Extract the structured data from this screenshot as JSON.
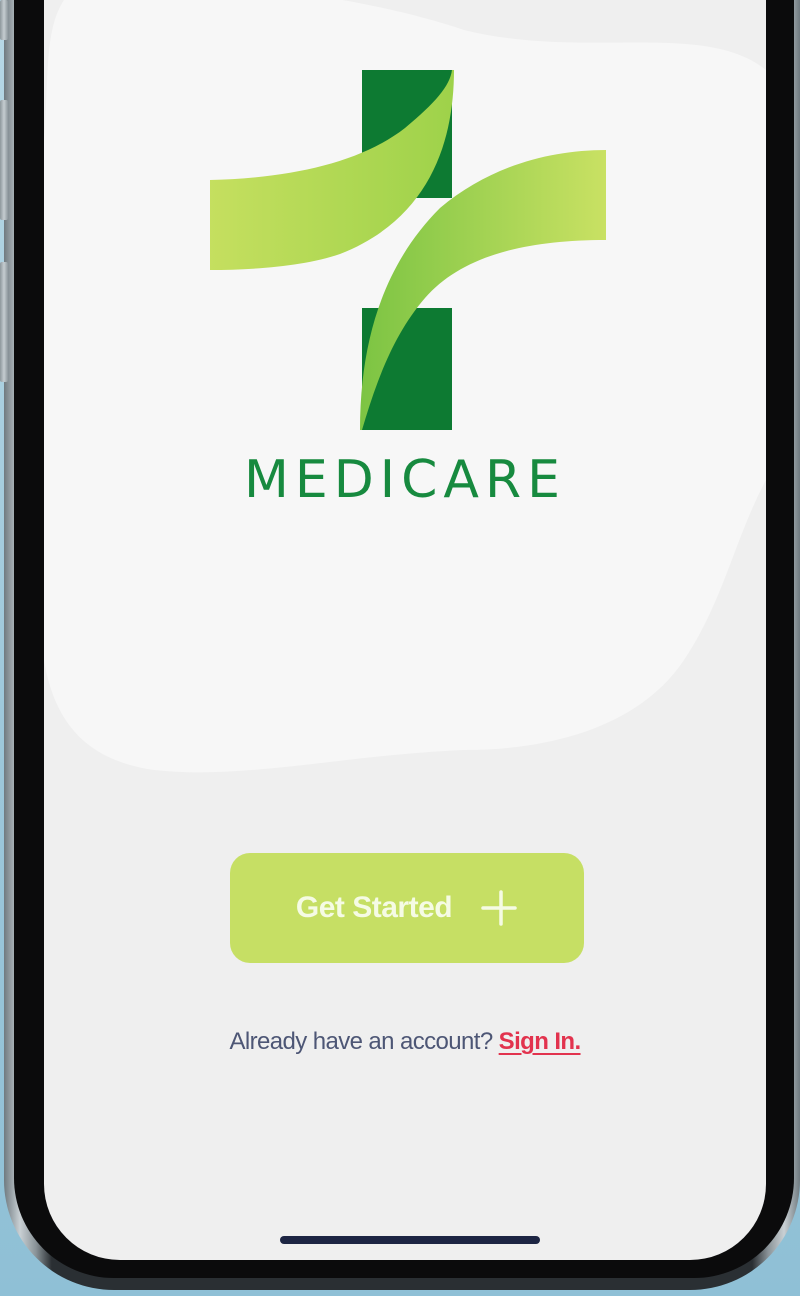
{
  "app": {
    "brand_name": "MEDICARE",
    "logo_icon": "medical-cross-logo-icon"
  },
  "onboarding": {
    "get_started_label": "Get Started",
    "get_started_icon": "plus-icon",
    "signin_prompt": "Already have an account?",
    "signin_link": "Sign In."
  },
  "colors": {
    "brand_dark_green": "#0d7a32",
    "brand_light_green": "#c6df64",
    "signin_red": "#e2334e",
    "text_slate": "#4d5675",
    "screen_background": "#efefef"
  }
}
